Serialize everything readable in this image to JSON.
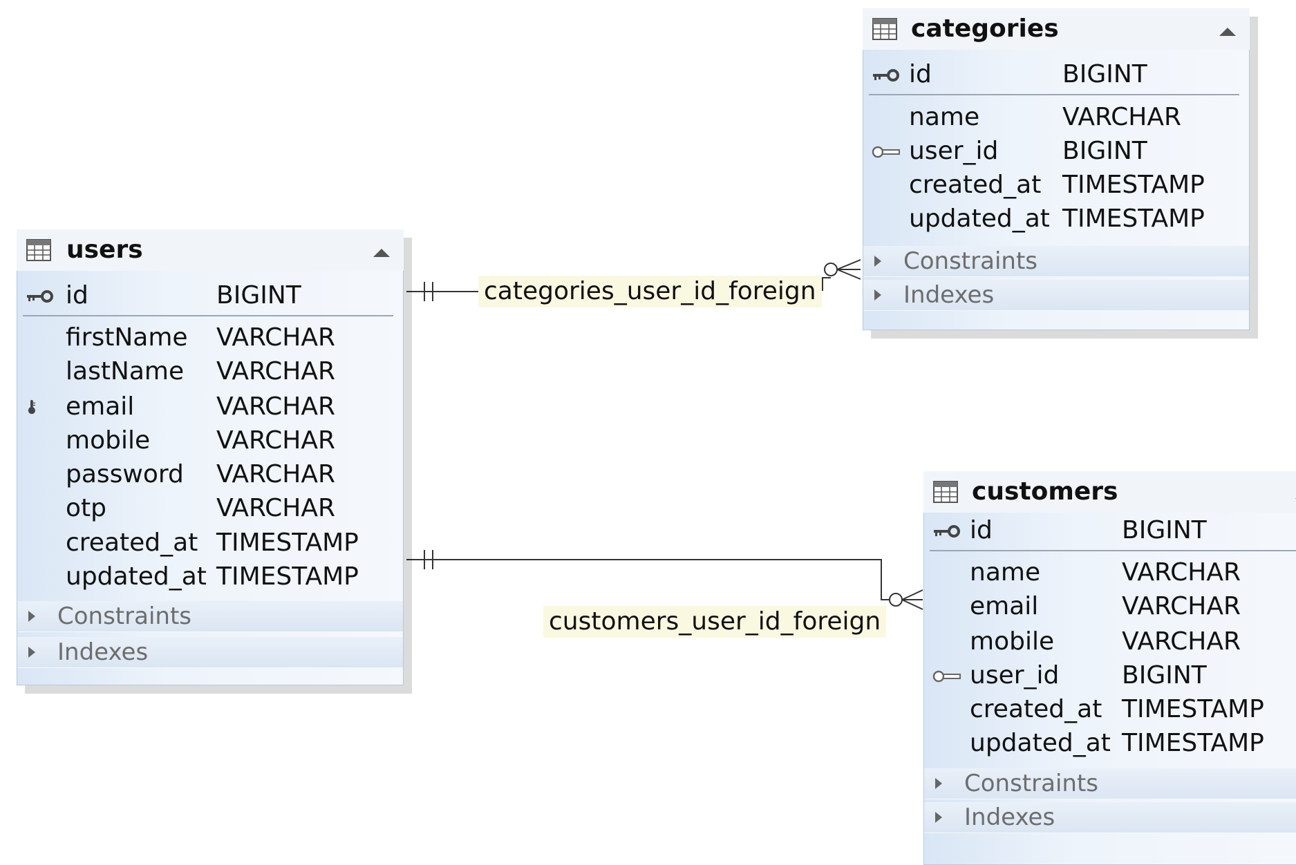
{
  "tables": {
    "users": {
      "name": "users",
      "columns": [
        {
          "name": "id",
          "type": "BIGINT",
          "key": "primary-key"
        },
        {
          "name": "firstName",
          "type": "VARCHAR"
        },
        {
          "name": "lastName",
          "type": "VARCHAR"
        },
        {
          "name": "email",
          "type": "VARCHAR",
          "key": "unique-key"
        },
        {
          "name": "mobile",
          "type": "VARCHAR"
        },
        {
          "name": "password",
          "type": "VARCHAR"
        },
        {
          "name": "otp",
          "type": "VARCHAR"
        },
        {
          "name": "created_at",
          "type": "TIMESTAMP"
        },
        {
          "name": "updated_at",
          "type": "TIMESTAMP"
        }
      ],
      "sections": [
        "Constraints",
        "Indexes"
      ]
    },
    "categories": {
      "name": "categories",
      "columns": [
        {
          "name": "id",
          "type": "BIGINT",
          "key": "primary-key"
        },
        {
          "name": "name",
          "type": "VARCHAR"
        },
        {
          "name": "user_id",
          "type": "BIGINT",
          "key": "foreign-key"
        },
        {
          "name": "created_at",
          "type": "TIMESTAMP"
        },
        {
          "name": "updated_at",
          "type": "TIMESTAMP"
        }
      ],
      "sections": [
        "Constraints",
        "Indexes"
      ]
    },
    "customers": {
      "name": "customers",
      "columns": [
        {
          "name": "id",
          "type": "BIGINT",
          "key": "primary-key"
        },
        {
          "name": "name",
          "type": "VARCHAR"
        },
        {
          "name": "email",
          "type": "VARCHAR"
        },
        {
          "name": "mobile",
          "type": "VARCHAR"
        },
        {
          "name": "user_id",
          "type": "BIGINT",
          "key": "foreign-key"
        },
        {
          "name": "created_at",
          "type": "TIMESTAMP"
        },
        {
          "name": "updated_at",
          "type": "TIMESTAMP"
        }
      ],
      "sections": [
        "Constraints",
        "Indexes"
      ]
    }
  },
  "relations": [
    {
      "name": "categories_user_id_foreign",
      "from": "users",
      "to": "categories"
    },
    {
      "name": "customers_user_id_foreign",
      "from": "users",
      "to": "customers"
    }
  ],
  "colors": {
    "line": "#333333",
    "label_bg": "#fbf8e2",
    "section_text": "#6d6d6d"
  }
}
